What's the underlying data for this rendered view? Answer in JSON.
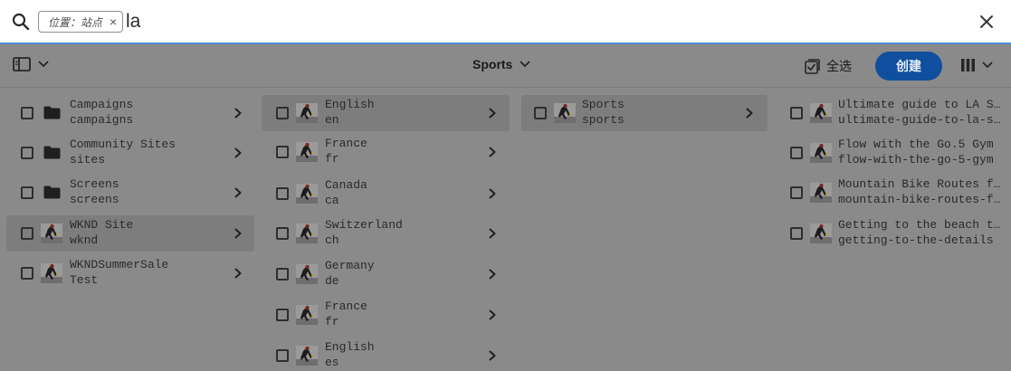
{
  "search": {
    "tag_label": "位置：站点",
    "tag_remove": "×",
    "query": "la"
  },
  "toolbar": {
    "breadcrumb": "Sports",
    "select_all": "全选",
    "create": "创建"
  },
  "columns": [
    {
      "items": [
        {
          "title": "Campaigns",
          "name": "campaigns",
          "icon": "folder-icon"
        },
        {
          "title": "Community Sites",
          "name": "sites",
          "icon": "folder-icon"
        },
        {
          "title": "Screens",
          "name": "screens",
          "icon": "folder-icon"
        },
        {
          "title": "WKND Site",
          "name": "wknd",
          "icon": "page-thumbnail-icon",
          "selected": true
        },
        {
          "title": "WKNDSummerSale",
          "name": "Test",
          "icon": "page-thumbnail-icon"
        }
      ]
    },
    {
      "items": [
        {
          "title": "English",
          "name": "en",
          "icon": "page-thumbnail-icon",
          "selected": true
        },
        {
          "title": "France",
          "name": "fr",
          "icon": "page-thumbnail-icon"
        },
        {
          "title": "Canada",
          "name": "ca",
          "icon": "page-thumbnail-icon"
        },
        {
          "title": "Switzerland",
          "name": "ch",
          "icon": "page-thumbnail-icon"
        },
        {
          "title": "Germany",
          "name": "de",
          "icon": "page-thumbnail-icon"
        },
        {
          "title": "France",
          "name": "fr",
          "icon": "page-thumbnail-icon"
        },
        {
          "title": "English",
          "name": "es",
          "icon": "page-thumbnail-icon"
        }
      ]
    },
    {
      "items": [
        {
          "title": "Sports",
          "name": "sports",
          "icon": "page-thumbnail-icon",
          "selected": true
        }
      ]
    },
    {
      "items": [
        {
          "title": "Ultimate guide to LA Surfing",
          "name": "ultimate-guide-to-la-surfing",
          "icon": "page-thumbnail-icon"
        },
        {
          "title": "Flow with the Go.5 Gym",
          "name": "flow-with-the-go-5-gym",
          "icon": "page-thumbnail-icon"
        },
        {
          "title": "Mountain Bike Routes for Beginners",
          "name": "mountain-bike-routes-for-beginners",
          "icon": "page-thumbnail-icon"
        },
        {
          "title": "Getting to the beach the details",
          "name": "getting-to-the-details",
          "icon": "page-thumbnail-icon"
        }
      ]
    }
  ],
  "colors": {
    "overlay": "#8a8a8a",
    "selected_row": "#7d7d7d",
    "accent": "#0f4f9e",
    "search_border": "#4b8bd6"
  }
}
